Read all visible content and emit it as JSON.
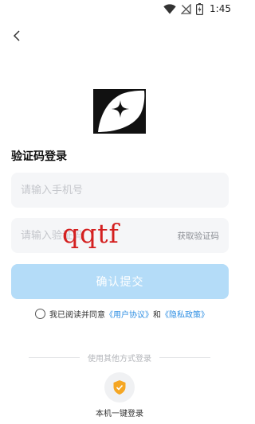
{
  "status_bar": {
    "time": "1:45",
    "icons": [
      "wifi-icon",
      "no-signal-icon",
      "battery-charging-icon"
    ]
  },
  "header": {
    "back_icon": "chevron-left-icon"
  },
  "logo": {
    "icon": "sparkle-fish-logo"
  },
  "form": {
    "title": "验证码登录",
    "phone_placeholder": "请输入手机号",
    "phone_value": "",
    "code_placeholder": "请输入验证码",
    "code_value": "",
    "get_code_label": "获取验证码",
    "submit_label": "确认提交"
  },
  "watermark_text": "qqtf",
  "agreement": {
    "checked": false,
    "prefix": "我已阅读并同意",
    "user_agreement": "《用户协议》",
    "and": "和",
    "privacy_policy": "《隐私政策》"
  },
  "alt_login": {
    "divider_text": "使用其他方式登录",
    "onekey_label": "本机一键登录",
    "onekey_icon": "shield-check-icon"
  },
  "colors": {
    "accent": "#2f8fe3",
    "button_disabled": "#b4dcf8",
    "field_bg": "#f5f6f8",
    "shield": "#f5a623",
    "watermark": "#d42020"
  }
}
